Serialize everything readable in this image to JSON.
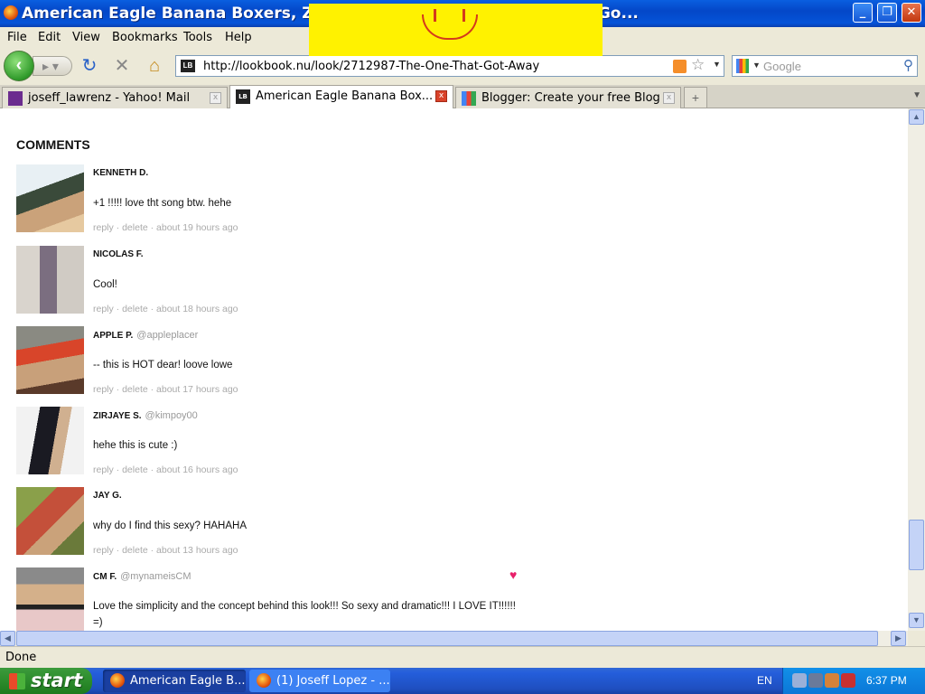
{
  "window": {
    "title": "American Eagle Banana Boxers, Zara Scarf, Scarf // \"The One That Go..."
  },
  "menu": [
    "File",
    "Edit",
    "View",
    "Bookmarks",
    "Tools",
    "Help"
  ],
  "nav": {
    "url": "http://lookbook.nu/look/2712987-The-One-That-Got-Away",
    "search_placeholder": "Google"
  },
  "tabs": [
    {
      "label": "joseff_lawrenz - Yahoo! Mail",
      "active": false
    },
    {
      "label": "American Eagle Banana Box...",
      "active": true
    },
    {
      "label": "Blogger: Create your free Blog",
      "active": false
    }
  ],
  "page": {
    "heading": "COMMENTS",
    "comments": [
      {
        "name": "KENNETH D.",
        "handle": "",
        "text": "+1 !!!!! love tht song btw. hehe",
        "meta": "reply · delete · about 19 hours ago"
      },
      {
        "name": "NICOLAS F.",
        "handle": "",
        "text": "Cool!",
        "meta": "reply · delete · about 18 hours ago"
      },
      {
        "name": "APPLE P.",
        "handle": "@appleplacer",
        "text": "-- this is HOT dear! loove lowe",
        "meta": "reply · delete · about 17 hours ago"
      },
      {
        "name": "ZIRJAYE S.",
        "handle": "@kimpoy00",
        "text": "hehe this is cute :)",
        "meta": "reply · delete · about 16 hours ago"
      },
      {
        "name": "JAY G.",
        "handle": "",
        "text": "why do I find this sexy? HAHAHA",
        "meta": "reply · delete · about 13 hours ago"
      },
      {
        "name": "CM F.",
        "handle": "@mynameisCM",
        "text": "Love the simplicity and the concept behind this look!!! So sexy and dramatic!!! I LOVE IT!!!!!! =)",
        "meta": ""
      }
    ]
  },
  "status": {
    "text": "Done"
  },
  "taskbar": {
    "start": "start",
    "buttons": [
      "American Eagle B...",
      "(1) Joseff Lopez - ..."
    ],
    "language": "EN",
    "clock": "6:37 PM"
  },
  "colors": {
    "title_blue": "#0a5fe0",
    "heart": "#e8206a",
    "meta_gray": "#aaaaaa"
  }
}
